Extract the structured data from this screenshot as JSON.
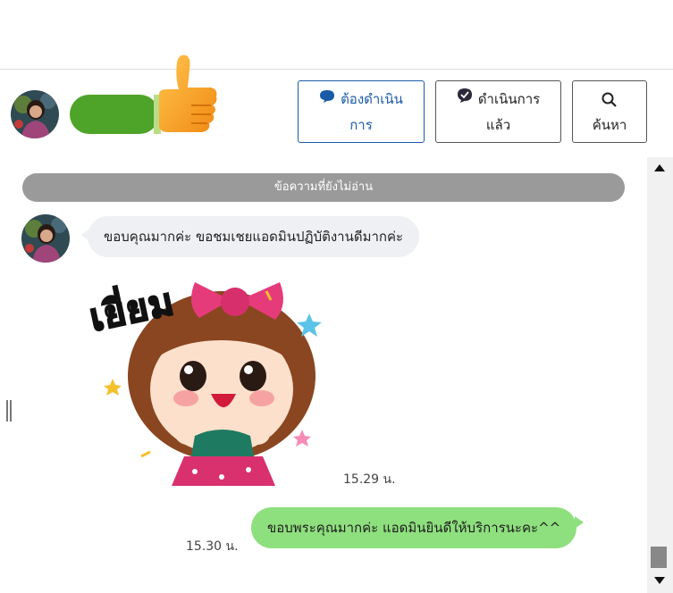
{
  "header": {
    "buttons": [
      {
        "label_line1": "ต้องดำเนิน",
        "label_line2": "การ",
        "icon": "chat-bubble-icon",
        "active": true
      },
      {
        "label_line1": "ดำเนินการ",
        "label_line2": "แล้ว",
        "icon": "check-circle-icon",
        "active": false
      },
      {
        "label_line1": "",
        "label_line2": "ค้นหา",
        "icon": "search-icon",
        "active": false
      }
    ],
    "accent_color": "#1a5aa6",
    "name_pill_color": "#4ea329"
  },
  "chat": {
    "unread_divider": "ข้อความที่ยังไม่อ่าน",
    "messages": [
      {
        "direction": "in",
        "text": "ขอบคุณมากค่ะ ขอชมเชยแอดมินปฏิบัติงานดีมากค่ะ"
      },
      {
        "direction": "in",
        "sticker_caption": "เยี่ยม",
        "time": "15.29 น."
      },
      {
        "direction": "out",
        "text": "ขอบพระคุณมากค่ะ  แอดมินยินดีให้บริการนะคะ^^",
        "time": "15.30 น."
      }
    ],
    "incoming_bubble_color": "#eef0f3",
    "outgoing_bubble_color": "#8ee07e"
  }
}
